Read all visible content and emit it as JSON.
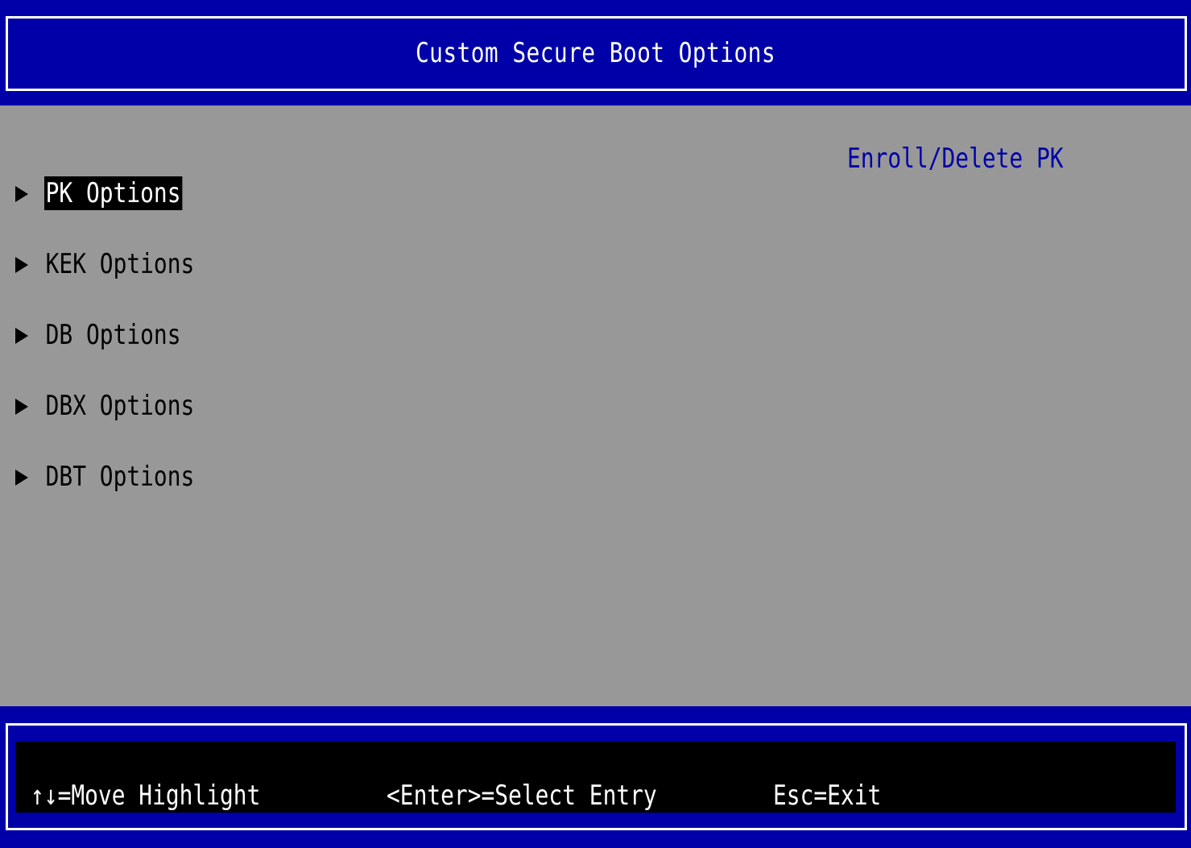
{
  "header": {
    "title": "Custom Secure Boot Options"
  },
  "menu": {
    "items": [
      {
        "label": "PK Options",
        "selected": true
      },
      {
        "label": "KEK Options",
        "selected": false
      },
      {
        "label": "DB Options",
        "selected": false
      },
      {
        "label": "DBX Options",
        "selected": false
      },
      {
        "label": "DBT Options",
        "selected": false
      }
    ]
  },
  "help": {
    "text": "Enroll/Delete PK"
  },
  "footer": {
    "move_hint": "↑↓=Move Highlight",
    "select_hint": "<Enter>=Select Entry",
    "exit_hint": "Esc=Exit"
  },
  "colors": {
    "frame_blue": "#0000a8",
    "body_gray": "#989898",
    "help_text": "#0000a8",
    "highlight_bg": "#000000",
    "highlight_fg": "#ffffff"
  }
}
